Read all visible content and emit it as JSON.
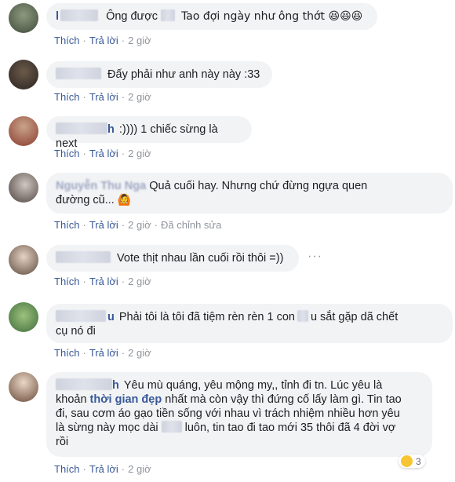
{
  "actions": {
    "like": "Thích",
    "reply": "Trả lời",
    "edited": "Đã chỉnh sửa"
  },
  "comments": [
    {
      "name": "l",
      "text": "Ông được",
      "text2": "Tao đợi ngày như ông thớt 😆😆😆",
      "time": "2 giờ"
    },
    {
      "text": "Đấy phải như anh này này :33",
      "time": "2 giờ"
    },
    {
      "name": "h",
      "text": ":)))) 1 chiếc sừng là next",
      "time": "2 giờ"
    },
    {
      "name": "Nguyễn Thu Nga",
      "text": "Quả cuối hay. Nhưng chứ đừng ngựa quen",
      "line2": "đường cũ...",
      "emoji": "🙆",
      "time": "2 giờ"
    },
    {
      "text": "Vote thịt nhau lần cuối rồi thôi =))",
      "time": "2 giờ"
    },
    {
      "name": "u",
      "text": "Phải tôi là tôi đã tiệm rèn rèn 1 con",
      "text_b": "u sắt gặp dã chết",
      "line2": "cụ nó đi",
      "time": "2 giờ"
    },
    {
      "name": "h",
      "line1": "Yêu mù quáng, yêu mộng my,, tỉnh đi tn. Lúc yêu là",
      "line2_a": "khoản",
      "line2_link": "thời gian đẹp",
      "line2_b": "nhất mà còn vậy thì đứng cố lấy làm gì. Tin tao",
      "line3": "đi, sau cơm áo gạo tiền sống với nhau vì trách nhiệm nhiều hơn yêu",
      "line4_a": "là sừng này mọc dài",
      "line4_b": "luôn, tin tao đi tao mới 35 thôi đã 4 đời vợ",
      "line5": "rồi",
      "reactions": "3",
      "time": "2 giờ"
    }
  ]
}
